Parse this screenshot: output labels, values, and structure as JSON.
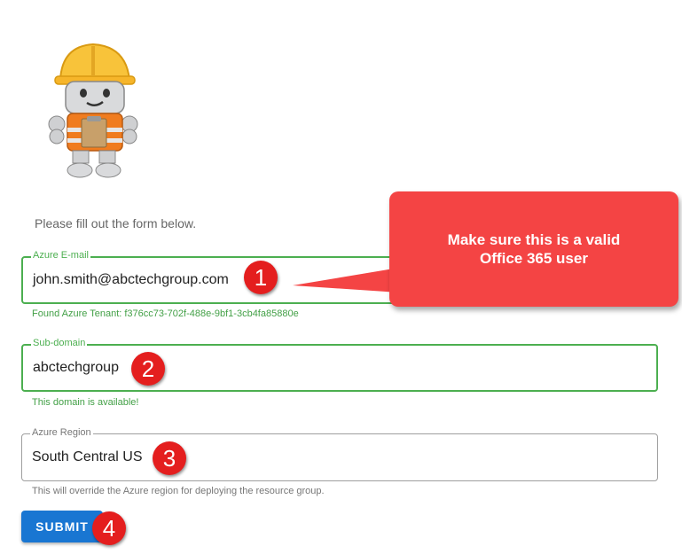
{
  "intro_text": "Please fill out the form below.",
  "fields": {
    "email": {
      "label": "Azure E-mail",
      "value": "john.smith@abctechgroup.com",
      "helper": "Found Azure Tenant: f376cc73-702f-488e-9bf1-3cb4fa85880e"
    },
    "subdomain": {
      "label": "Sub-domain",
      "value": "abctechgroup",
      "helper": "This domain is available!"
    },
    "region": {
      "label": "Azure Region",
      "value": "South Central US",
      "helper": "This will override the Azure region for deploying the resource group."
    }
  },
  "submit_label": "SUBMIT",
  "callout": {
    "line1": "Make sure this is a valid",
    "line2": "Office 365 user"
  },
  "badges": [
    "1",
    "2",
    "3",
    "4"
  ],
  "colors": {
    "success": "#4caf50",
    "primary": "#1976d2",
    "callout": "#f44444",
    "badge": "#e41e1e"
  }
}
